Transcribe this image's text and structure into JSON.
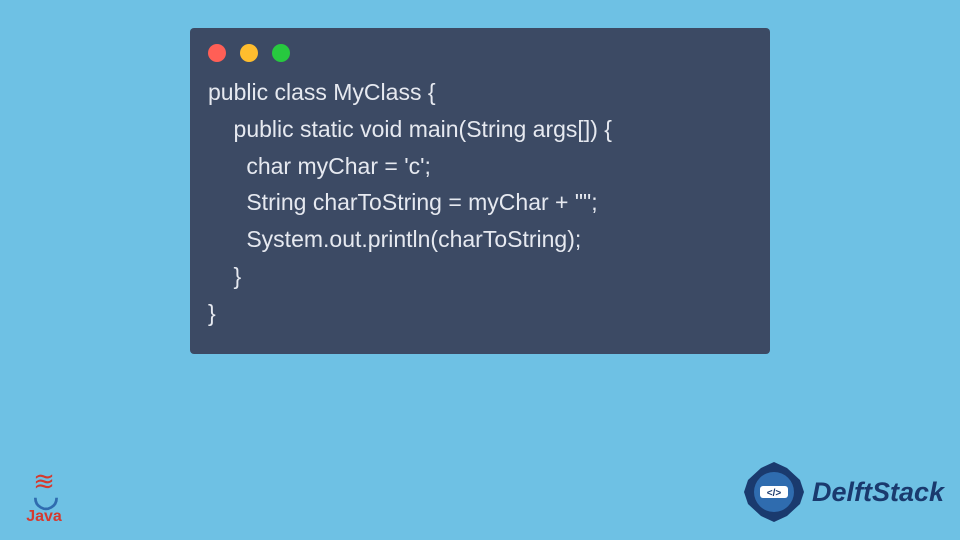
{
  "code": {
    "line1": "public class MyClass {",
    "line2": "    public static void main(String args[]) {",
    "line3": "      char myChar = 'c';",
    "line4": "      String charToString = myChar + \"\";",
    "line5": "      System.out.println(charToString);",
    "line6": "    }",
    "line7": "}"
  },
  "logos": {
    "java_label": "Java",
    "delft_label": "DelftStack"
  },
  "window": {
    "dot_red": "#ff5f56",
    "dot_yellow": "#ffbd2e",
    "dot_green": "#27c93f"
  }
}
